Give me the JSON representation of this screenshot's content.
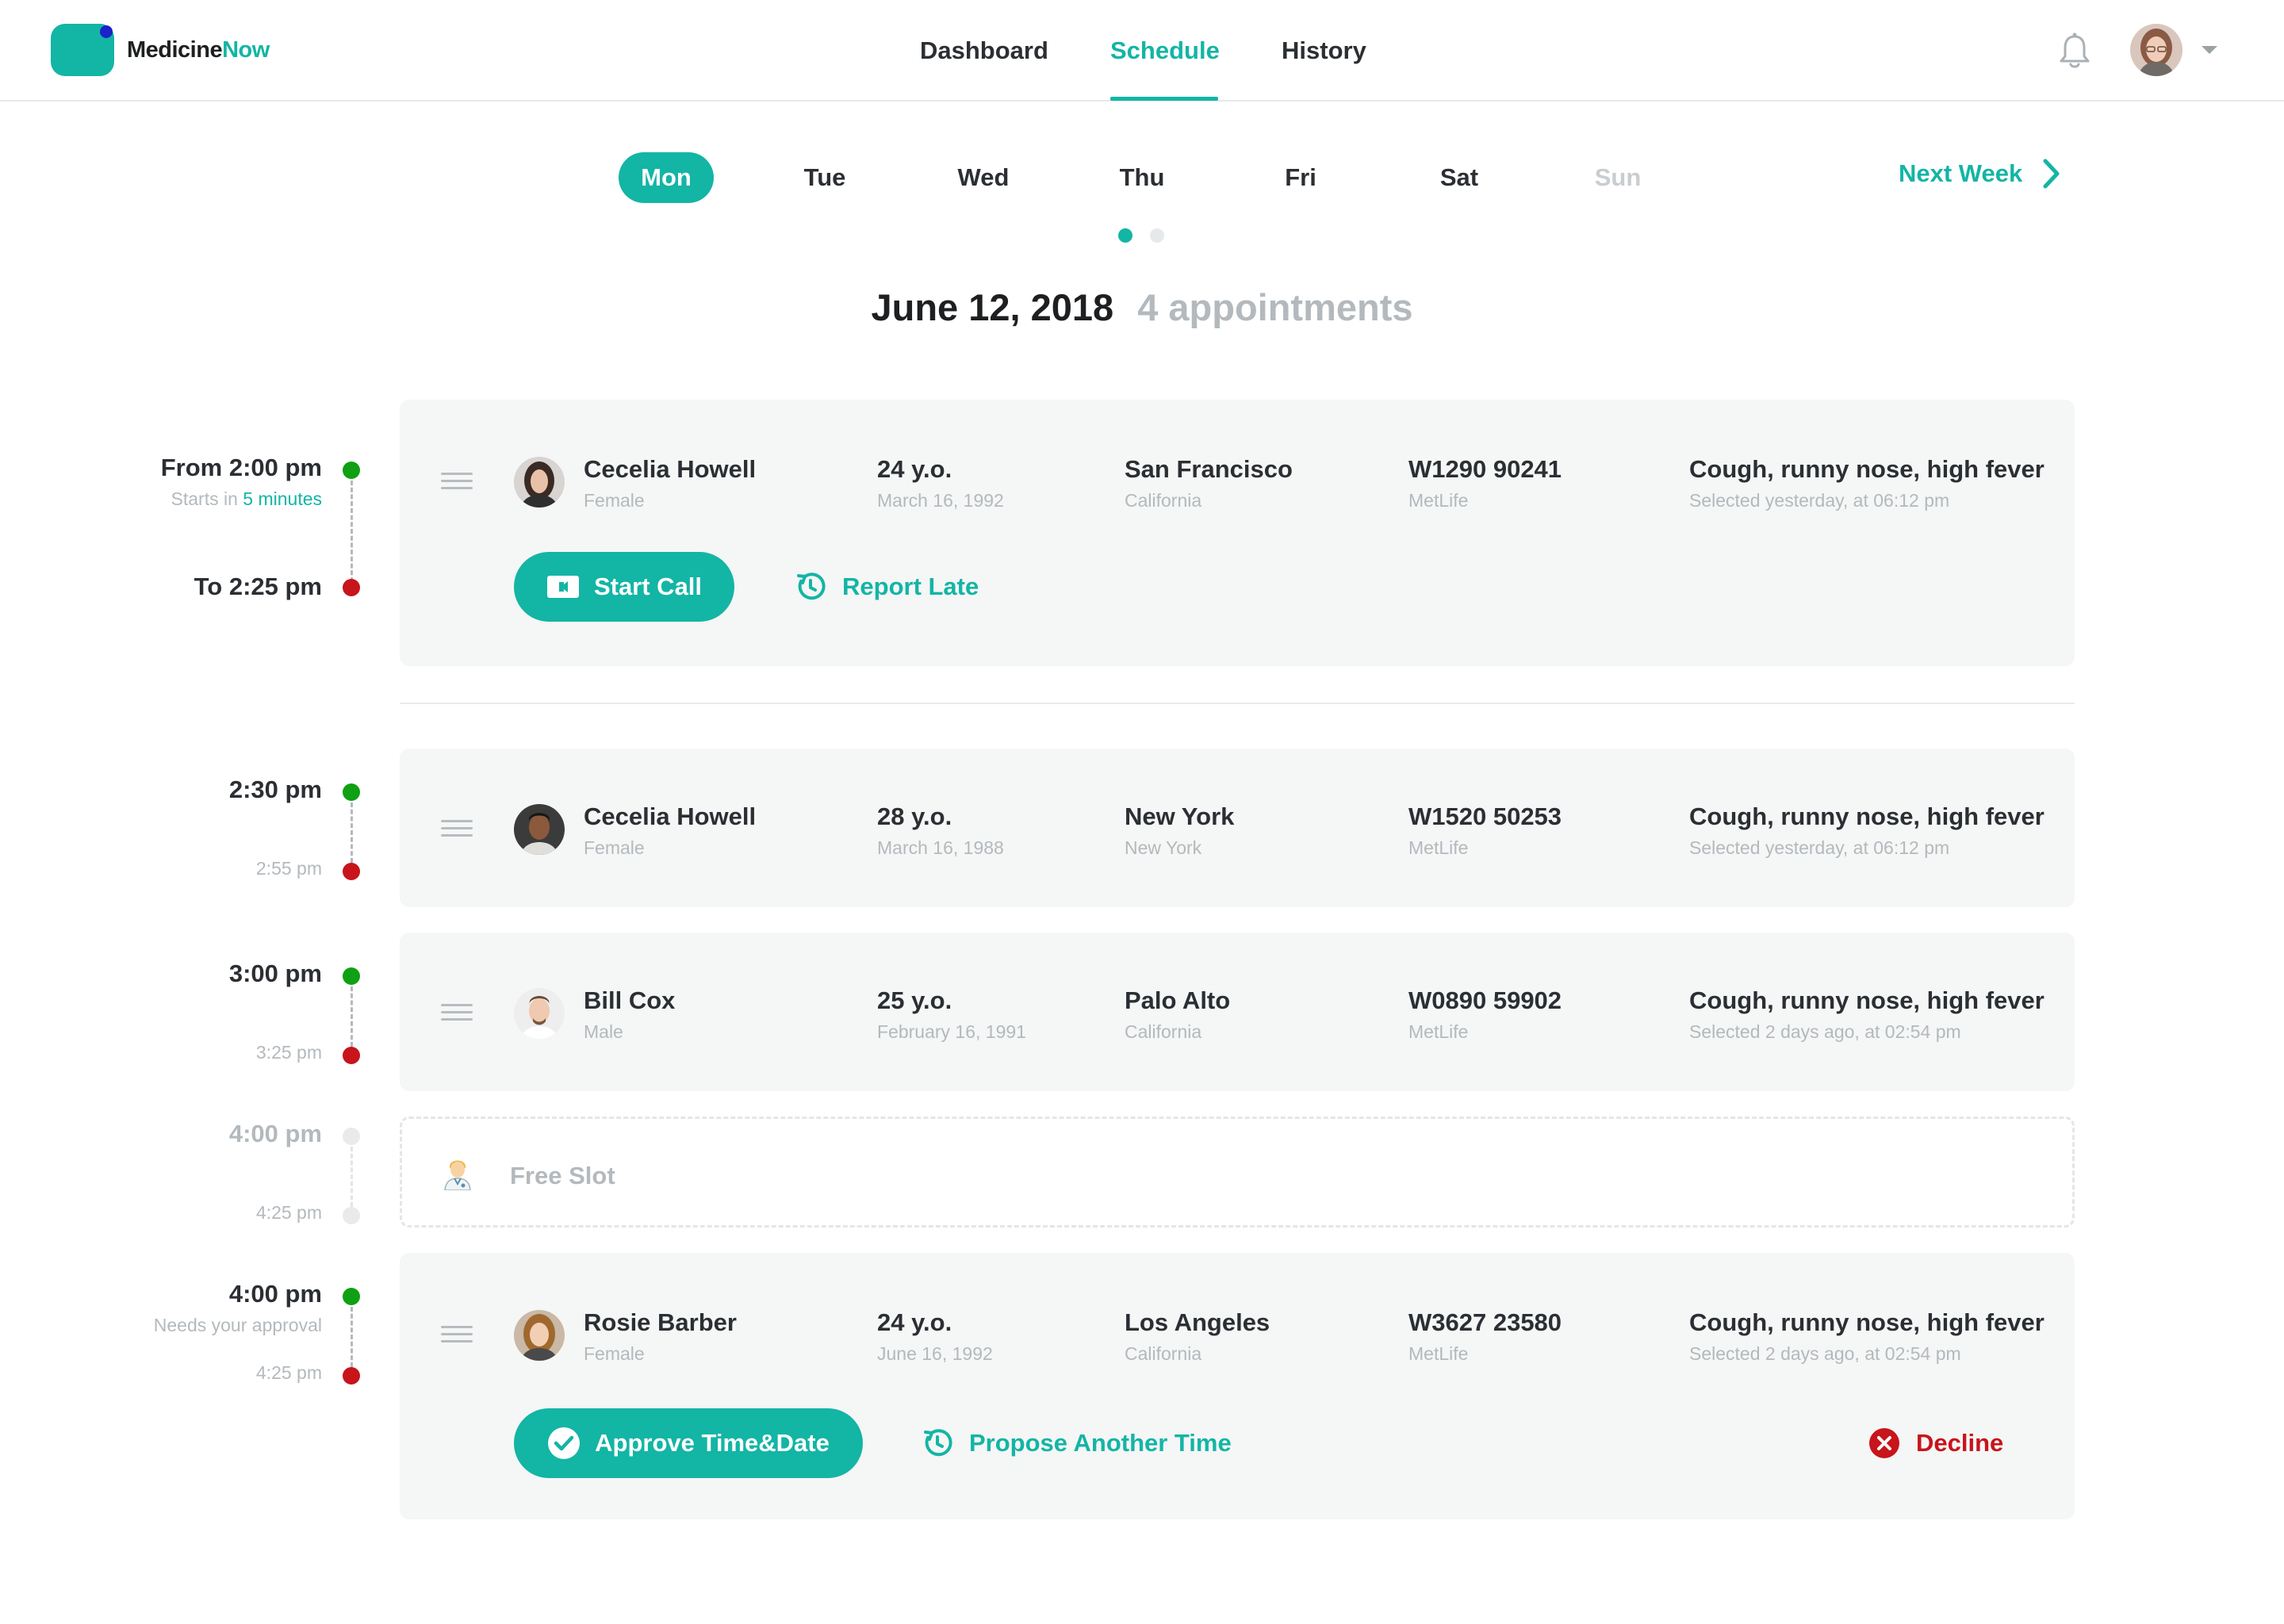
{
  "brand": {
    "name_a": "Medicine",
    "name_b": "Now",
    "primary": "#13b5a5",
    "success": "#0fa013",
    "danger": "#c8141b"
  },
  "nav": {
    "dashboard": "Dashboard",
    "schedule": "Schedule",
    "history": "History",
    "active": "Schedule"
  },
  "header": {
    "notifications_icon": "bell-icon",
    "user_menu_icon": "chevron-down-icon"
  },
  "days": [
    "Mon",
    "Tue",
    "Wed",
    "Thu",
    "Fri",
    "Sat",
    "Sun"
  ],
  "selected_day": "Mon",
  "disabled_day": "Sun",
  "next_week": "Next Week",
  "week_pager": {
    "pages": 2,
    "current": 1
  },
  "date": "June 12, 2018",
  "appointments_count": "4 appointments",
  "timeline": [
    {
      "from": "From 2:00 pm",
      "note_prefix": "Starts in",
      "note_highlight": "5 minutes",
      "to": "To 2:25 pm"
    },
    {
      "from": "2:30 pm",
      "to": "2:55 pm"
    },
    {
      "from": "3:00 pm",
      "to": "3:25 pm"
    },
    {
      "from": "4:00 pm",
      "to": "4:25 pm"
    },
    {
      "from": "4:00 pm",
      "note": "Needs your approval",
      "to": "4:25 pm"
    }
  ],
  "appointments": [
    {
      "name": "Cecelia Howell",
      "gender": "Female",
      "age": "24 y.o.",
      "dob": "March 16, 1992",
      "city": "San Francisco",
      "region": "California",
      "policy": "W1290 90241",
      "insurer": "MetLife",
      "symptoms": "Cough, runny nose, high fever",
      "selected": "Selected yesterday, at 06:12 pm"
    },
    {
      "name": "Cecelia Howell",
      "gender": "Female",
      "age": "28 y.o.",
      "dob": "March 16, 1988",
      "city": "New York",
      "region": "New York",
      "policy": "W1520 50253",
      "insurer": "MetLife",
      "symptoms": "Cough, runny nose, high fever",
      "selected": "Selected yesterday, at 06:12 pm"
    },
    {
      "name": "Bill Cox",
      "gender": "Male",
      "age": "25 y.o.",
      "dob": "February 16, 1991",
      "city": "Palo Alto",
      "region": "California",
      "policy": "W0890 59902",
      "insurer": "MetLife",
      "symptoms": "Cough, runny nose, high fever",
      "selected": "Selected 2 days ago, at 02:54 pm"
    },
    {
      "name": "Rosie Barber",
      "gender": "Female",
      "age": "24 y.o.",
      "dob": "June 16, 1992",
      "city": "Los Angeles",
      "region": "California",
      "policy": "W3627 23580",
      "insurer": "MetLife",
      "symptoms": "Cough, runny nose, high fever",
      "selected": "Selected 2 days ago, at 02:54 pm"
    }
  ],
  "free_slot": {
    "label": "Free Slot",
    "icon": "doctor-icon"
  },
  "actions": {
    "start_call": "Start Call",
    "report_late": "Report Late",
    "approve": "Approve Time&Date",
    "propose": "Propose Another Time",
    "decline": "Decline"
  }
}
